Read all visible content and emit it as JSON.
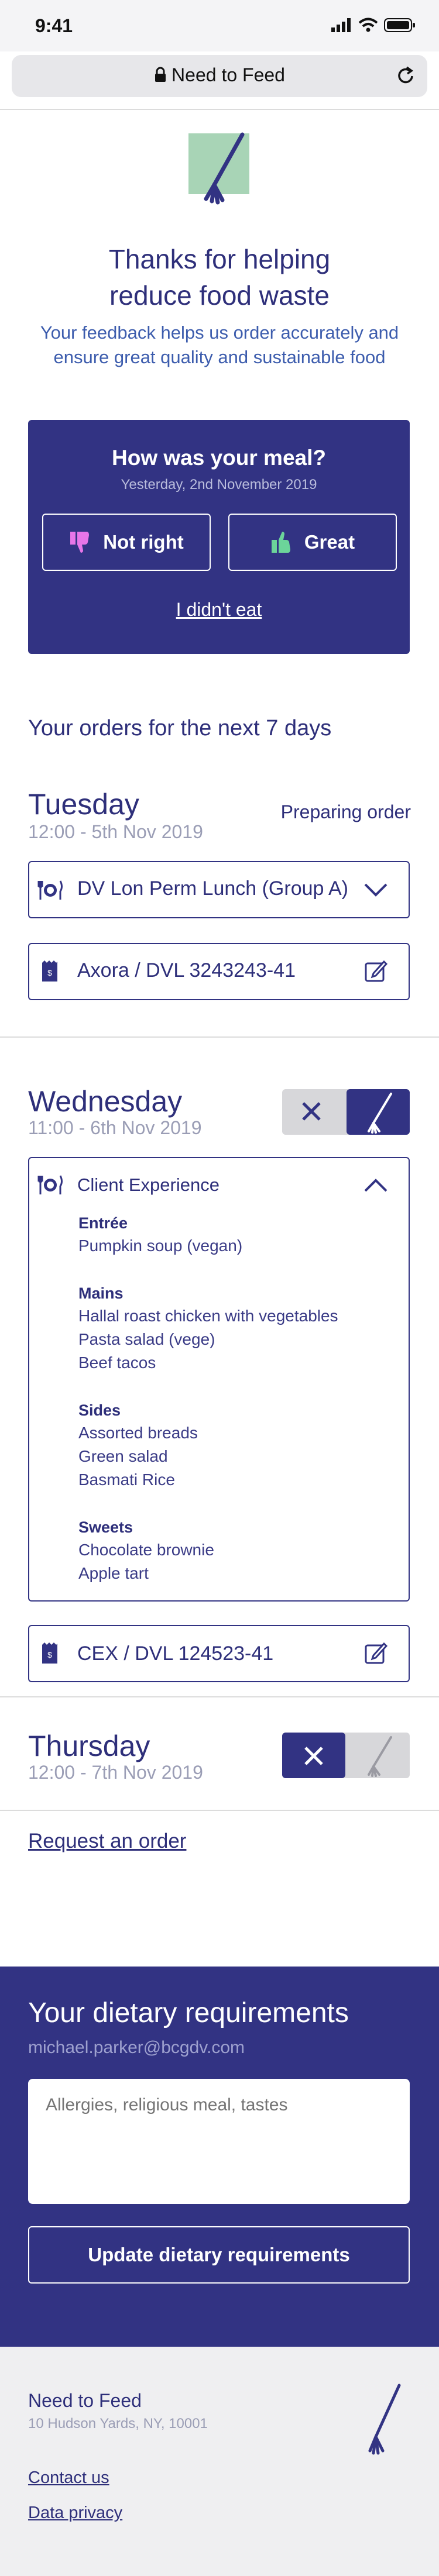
{
  "statusbar": {
    "time": "9:41"
  },
  "browser": {
    "url_title": "Need to Feed"
  },
  "header": {
    "title_line1": "Thanks for helping",
    "title_line2": "reduce food waste",
    "subtitle_line1": "Your feedback helps us order accurately and",
    "subtitle_line2": "ensure great quality and sustainable food"
  },
  "feedback": {
    "title": "How was your meal?",
    "date": "Yesterday, 2nd November 2019",
    "not_right_label": "Not right",
    "great_label": "Great",
    "didnt_eat_label": "I didn't eat",
    "not_right_color": "#e776e8",
    "great_color": "#6cd49a"
  },
  "orders": {
    "section_title": "Your orders for the next 7 days",
    "days": [
      {
        "name": "Tuesday",
        "date": "12:00 - 5th Nov 2019",
        "status": "Preparing order",
        "meal": "DV Lon Perm Lunch (Group A)",
        "cost_center": "Axora / DVL 3243243-41"
      },
      {
        "name": "Wednesday",
        "date": "11:00 - 6th Nov 2019",
        "meal": "Client Experience",
        "cost_center": "CEX / DVL 124523-41",
        "menu": [
          {
            "heading": "Entrée",
            "items": [
              "Pumpkin soup (vegan)"
            ]
          },
          {
            "heading": "Mains",
            "items": [
              "Hallal roast chicken with vegetables",
              "Pasta salad (vege)",
              "Beef tacos"
            ]
          },
          {
            "heading": "Sides",
            "items": [
              "Assorted breads",
              "Green salad",
              "Basmati Rice"
            ]
          },
          {
            "heading": "Sweets",
            "items": [
              "Chocolate brownie",
              "Apple tart"
            ]
          }
        ]
      },
      {
        "name": "Thursday",
        "date": "12:00 - 7th Nov 2019"
      }
    ],
    "request_link": "Request an order"
  },
  "dietary": {
    "title": "Your dietary requirements",
    "email": "michael.parker@bcgdv.com",
    "placeholder": "Allergies, religious meal, tastes",
    "button_label": "Update dietary requirements"
  },
  "footer": {
    "brand": "Need to Feed",
    "address": "10 Hudson Yards, NY, 10001",
    "contact_link": "Contact us",
    "privacy_link": "Data privacy"
  },
  "colors": {
    "primary": "#323383",
    "accent_green": "#a8d4b6",
    "text_blue": "#3c5cad",
    "muted": "#9a9db5"
  }
}
